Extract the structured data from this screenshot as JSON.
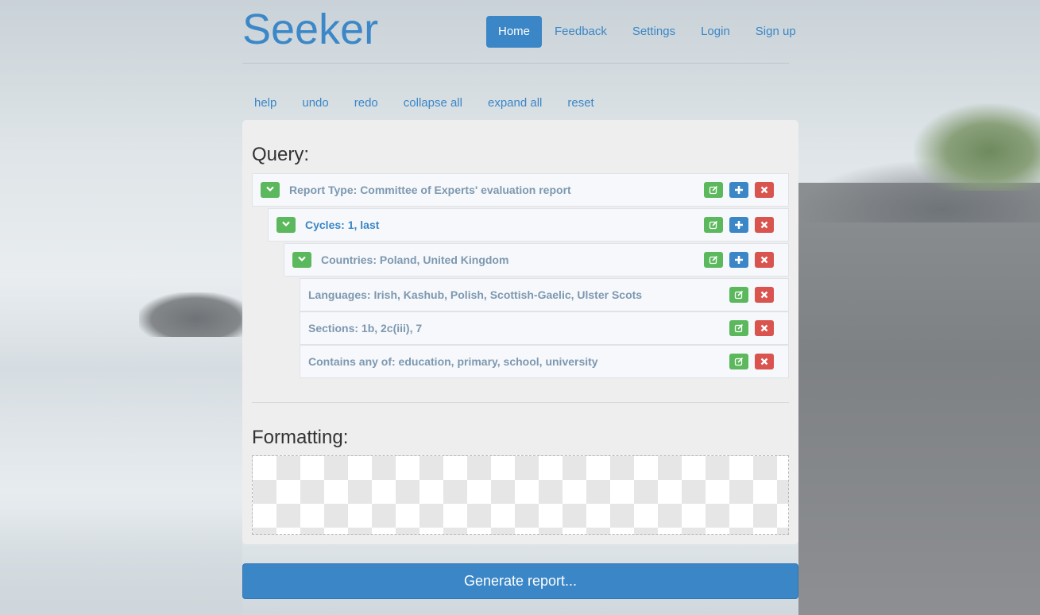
{
  "header": {
    "logo": "Seeker",
    "nav": [
      {
        "label": "Home",
        "active": true
      },
      {
        "label": "Feedback",
        "active": false
      },
      {
        "label": "Settings",
        "active": false
      },
      {
        "label": "Login",
        "active": false
      },
      {
        "label": "Sign up",
        "active": false
      }
    ]
  },
  "toolbar": {
    "help": "help",
    "undo": "undo",
    "redo": "redo",
    "collapse_all": "collapse all",
    "expand_all": "expand all",
    "reset": "reset"
  },
  "query": {
    "title": "Query:",
    "rows": [
      {
        "label": "Report Type: Committee of Experts' evaluation report",
        "collapsible": true,
        "actions": [
          "edit-icon",
          "add-icon",
          "delete-icon"
        ]
      },
      {
        "label": "Cycles: 1, last",
        "collapsible": true,
        "actions": [
          "edit-icon",
          "add-icon",
          "delete-icon"
        ]
      },
      {
        "label": "Countries: Poland, United Kingdom",
        "collapsible": true,
        "actions": [
          "edit-icon",
          "add-icon",
          "delete-icon"
        ]
      },
      {
        "label": "Languages: Irish, Kashub, Polish, Scottish-Gaelic, Ulster Scots",
        "collapsible": false,
        "actions": [
          "edit-icon",
          "delete-icon"
        ]
      },
      {
        "label": "Sections: 1b, 2c(iii), 7",
        "collapsible": false,
        "actions": [
          "edit-icon",
          "delete-icon"
        ]
      },
      {
        "label": "Contains any of: education, primary, school, university",
        "collapsible": false,
        "actions": [
          "edit-icon",
          "delete-icon"
        ]
      }
    ]
  },
  "formatting": {
    "title": "Formatting:"
  },
  "generate_label": "Generate report...",
  "colors": {
    "primary": "#3a86c6",
    "success": "#5cb85c",
    "danger": "#d9534f"
  }
}
